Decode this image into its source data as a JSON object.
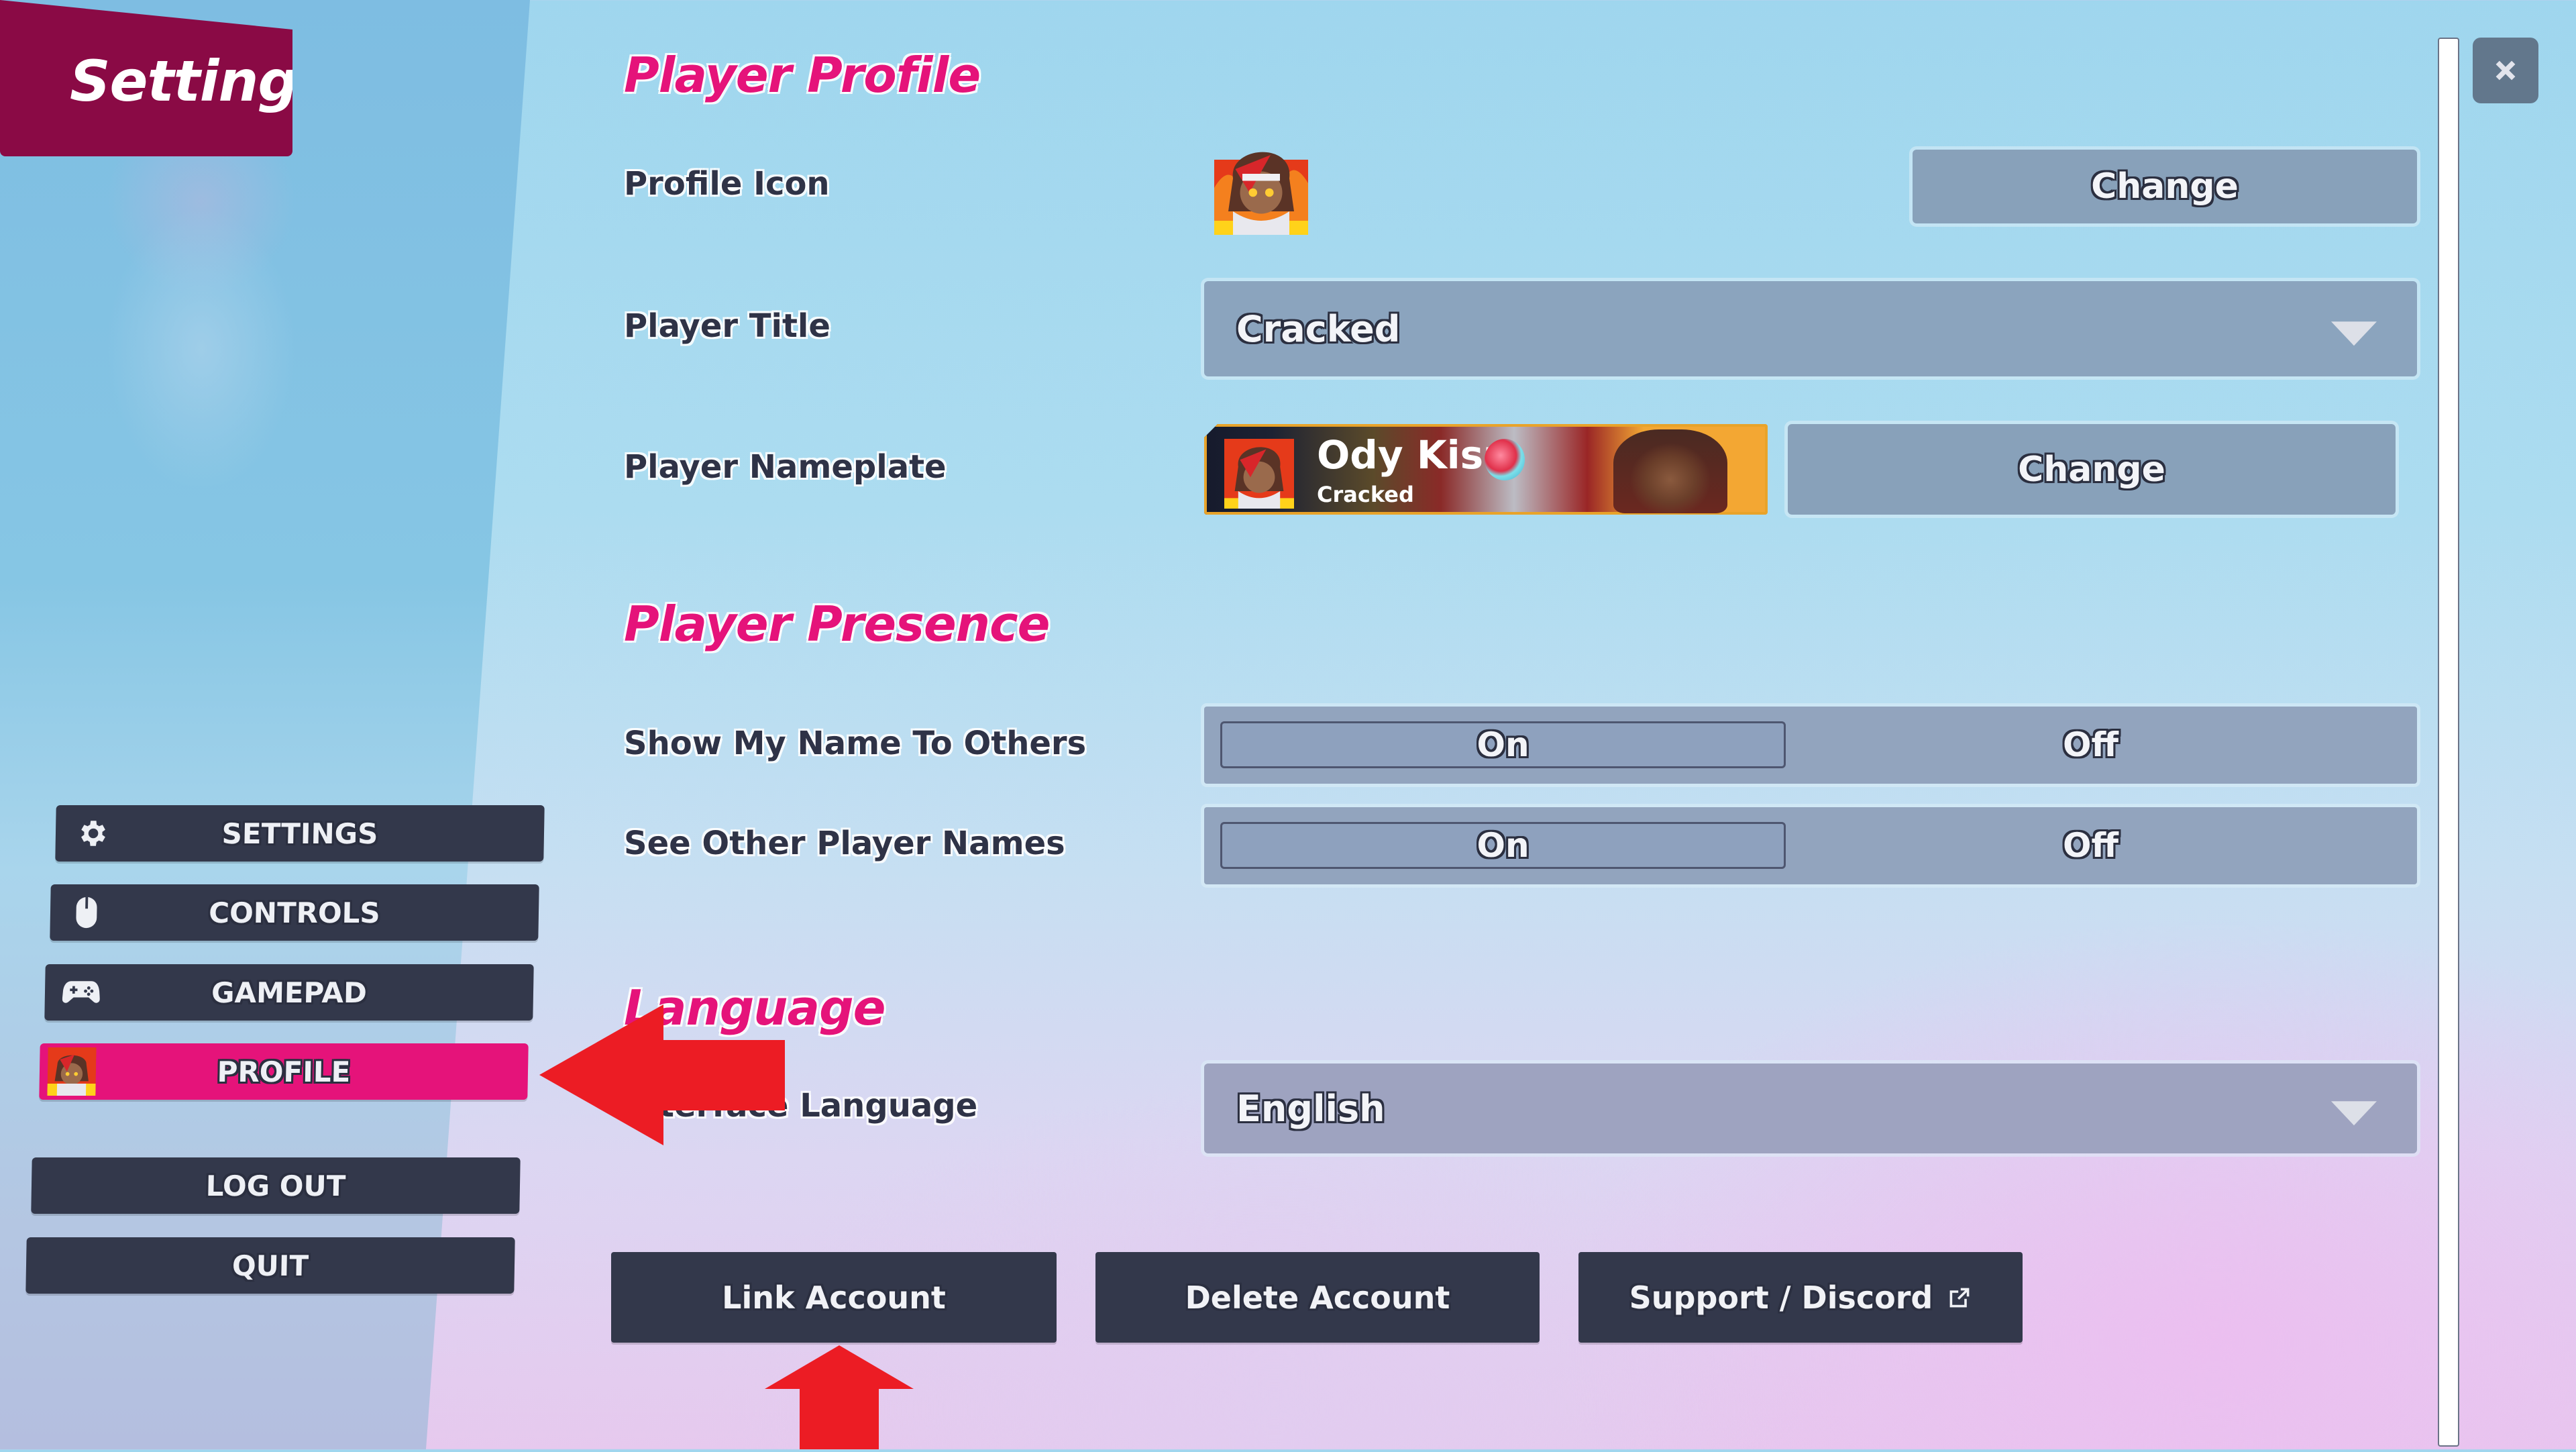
{
  "header": {
    "title": "Settings"
  },
  "sidebar": {
    "items": [
      {
        "label": "SETTINGS",
        "icon": "gear-icon",
        "active": false
      },
      {
        "label": "CONTROLS",
        "icon": "mouse-icon",
        "active": false
      },
      {
        "label": "GAMEPAD",
        "icon": "gamepad-icon",
        "active": false
      },
      {
        "label": "PROFILE",
        "icon": "profile-avatar-icon",
        "active": true
      }
    ],
    "log_out_label": "LOG OUT",
    "quit_label": "QUIT"
  },
  "player_profile": {
    "heading": "Player Profile",
    "profile_icon_label": "Profile Icon",
    "profile_icon_change_label": "Change",
    "player_title_label": "Player Title",
    "player_title_value": "Cracked",
    "player_nameplate_label": "Player Nameplate",
    "nameplate": {
      "name": "Ody Kisu",
      "title": "Cracked"
    },
    "nameplate_change_label": "Change"
  },
  "player_presence": {
    "heading": "Player Presence",
    "rows": [
      {
        "label": "Show My Name To Others",
        "on_label": "On",
        "off_label": "Off",
        "selected": "On"
      },
      {
        "label": "See Other Player  Names",
        "on_label": "On",
        "off_label": "Off",
        "selected": "On"
      }
    ]
  },
  "language": {
    "heading": "Language",
    "interface_language_label": "Interface Language",
    "interface_language_value": "English"
  },
  "account_actions": {
    "link_account_label": "Link Account",
    "delete_account_label": "Delete Account",
    "support_discord_label": "Support / Discord"
  },
  "colors": {
    "accent_pink": "#e5137a",
    "header_maroon": "#8a0a45",
    "dark_button": "#33384b",
    "slate_control": "#88a1ba",
    "annotation_red": "#ec1c24"
  }
}
